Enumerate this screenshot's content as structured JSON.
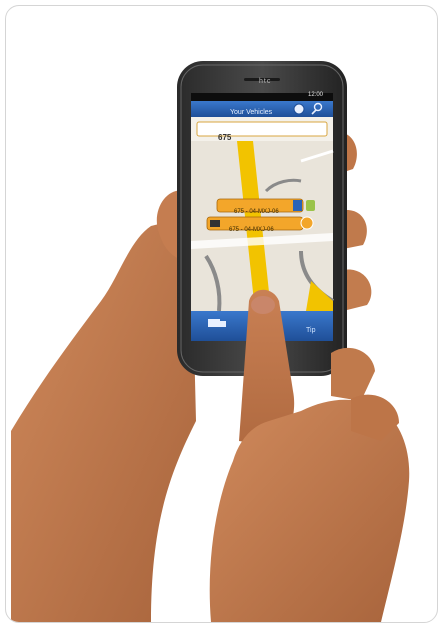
{
  "phone": {
    "brand": "htc",
    "status_time": "12:00"
  },
  "app": {
    "title": "Your Vehicles",
    "search_value": "675",
    "map_pins": [
      {
        "label": "675 - 04-MXJ-06"
      },
      {
        "label": "675 - 04-MXJ-06"
      }
    ],
    "bottom_tabs": [
      {
        "icon": "truck-icon",
        "label": ""
      },
      {
        "icon": "more-icon",
        "label": "Tip"
      }
    ]
  },
  "colors": {
    "app_bar": "#2a63b8",
    "map_bg": "#e9e4da",
    "road_yellow": "#f2c300",
    "pin_orange": "#f3a62a",
    "skin": "#c07a4e"
  }
}
